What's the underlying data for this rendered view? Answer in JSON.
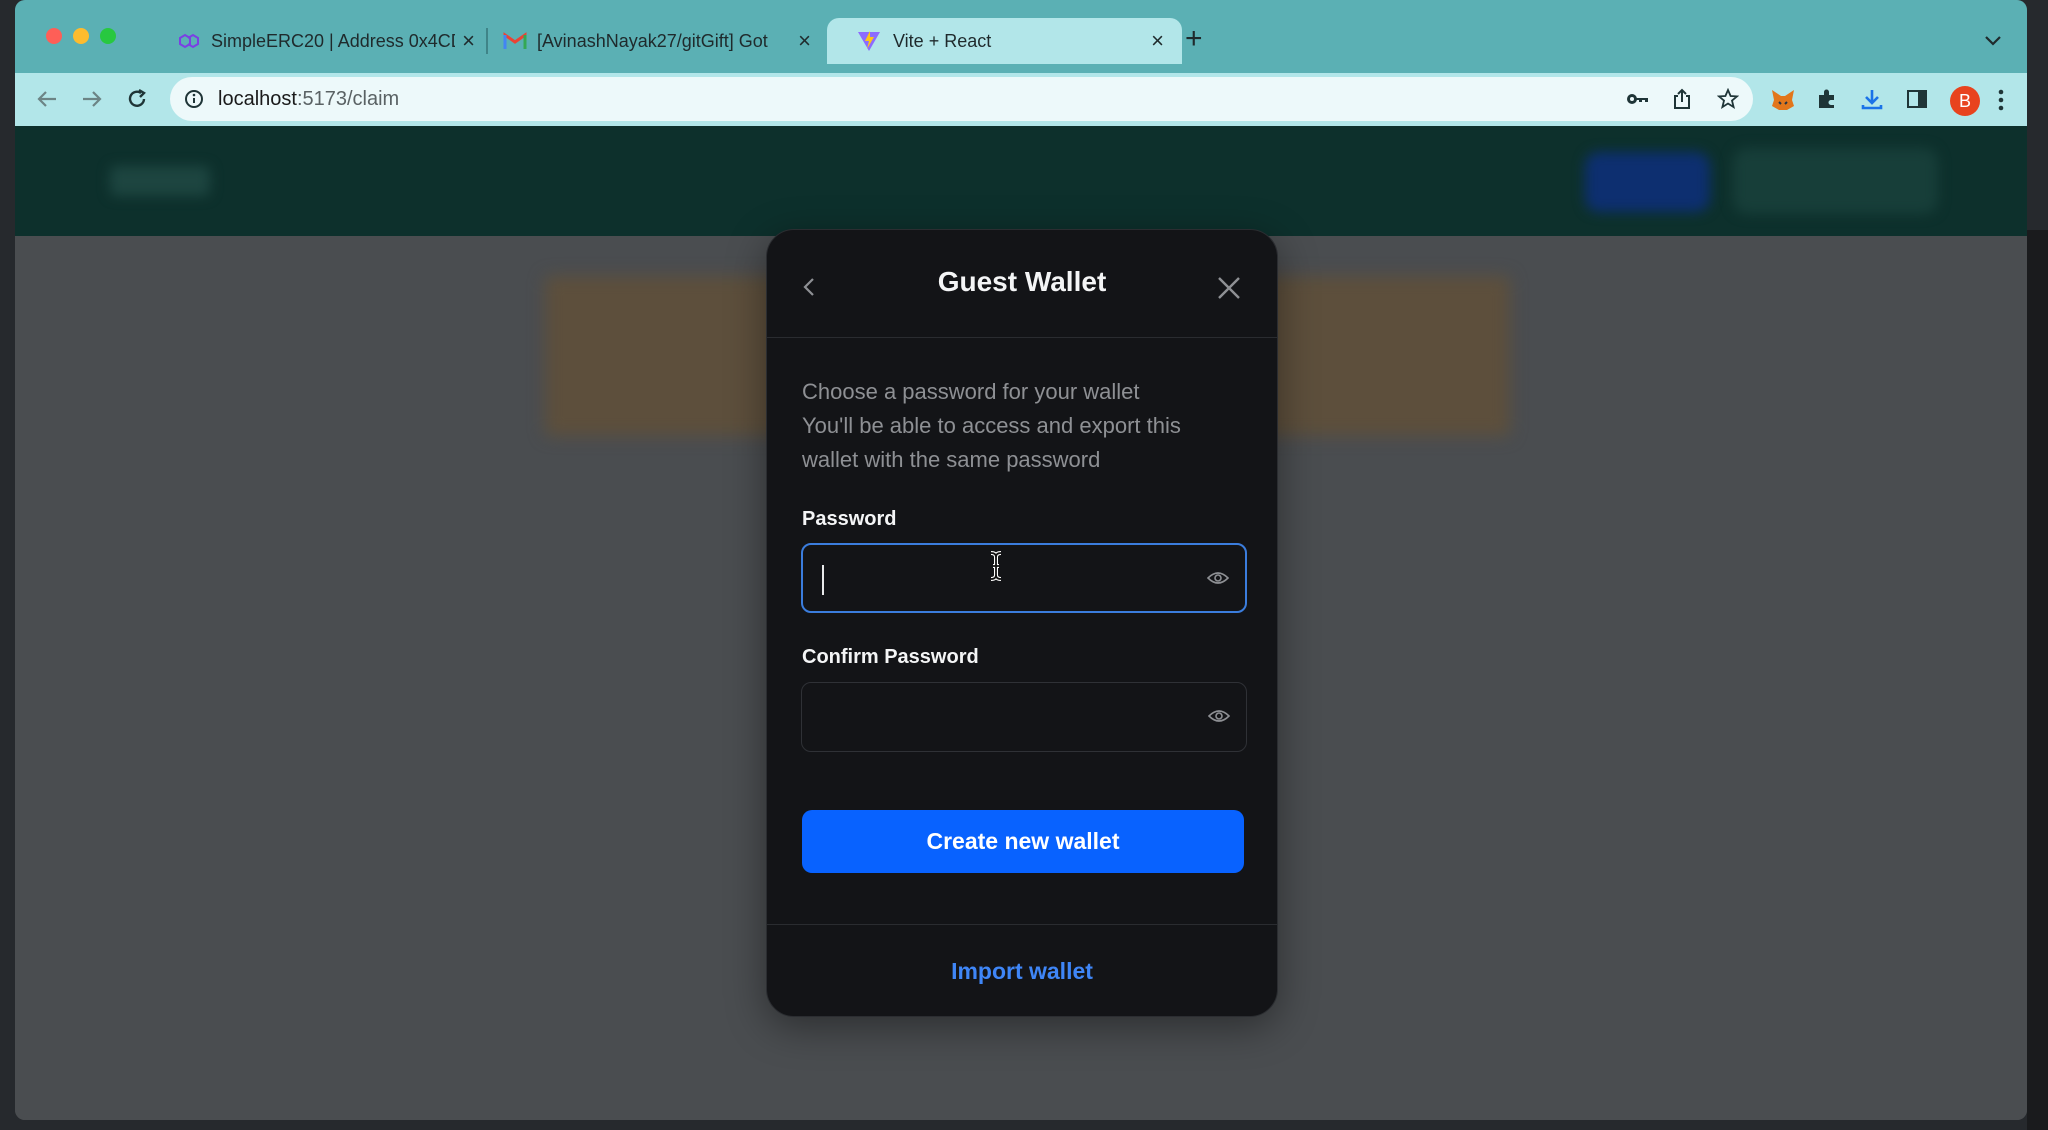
{
  "browser": {
    "tabs": [
      {
        "title": "SimpleERC20 | Address 0x4CD",
        "close": "×"
      },
      {
        "title": "[AvinashNayak27/gitGift] Got",
        "close": "×"
      },
      {
        "title": "Vite + React",
        "close": "×"
      }
    ],
    "new_tab": "+",
    "url": {
      "host": "localhost",
      "path": ":5173/claim"
    },
    "profile_initial": "B"
  },
  "modal": {
    "title": "Guest Wallet",
    "description_lines": [
      "Choose a password for your wallet",
      "You'll be able to access and export this",
      "wallet with the same password"
    ],
    "password_label": "Password",
    "password_value": "",
    "confirm_label": "Confirm Password",
    "confirm_value": "",
    "create_button": "Create new wallet",
    "import_link": "Import wallet"
  },
  "colors": {
    "tab_strip": "#5bb0b4",
    "toolbar": "#b2e6e9",
    "modal_bg": "#131417",
    "primary_button": "#0862ff",
    "link": "#3f86f7",
    "focus_ring": "#3b7ddd"
  }
}
